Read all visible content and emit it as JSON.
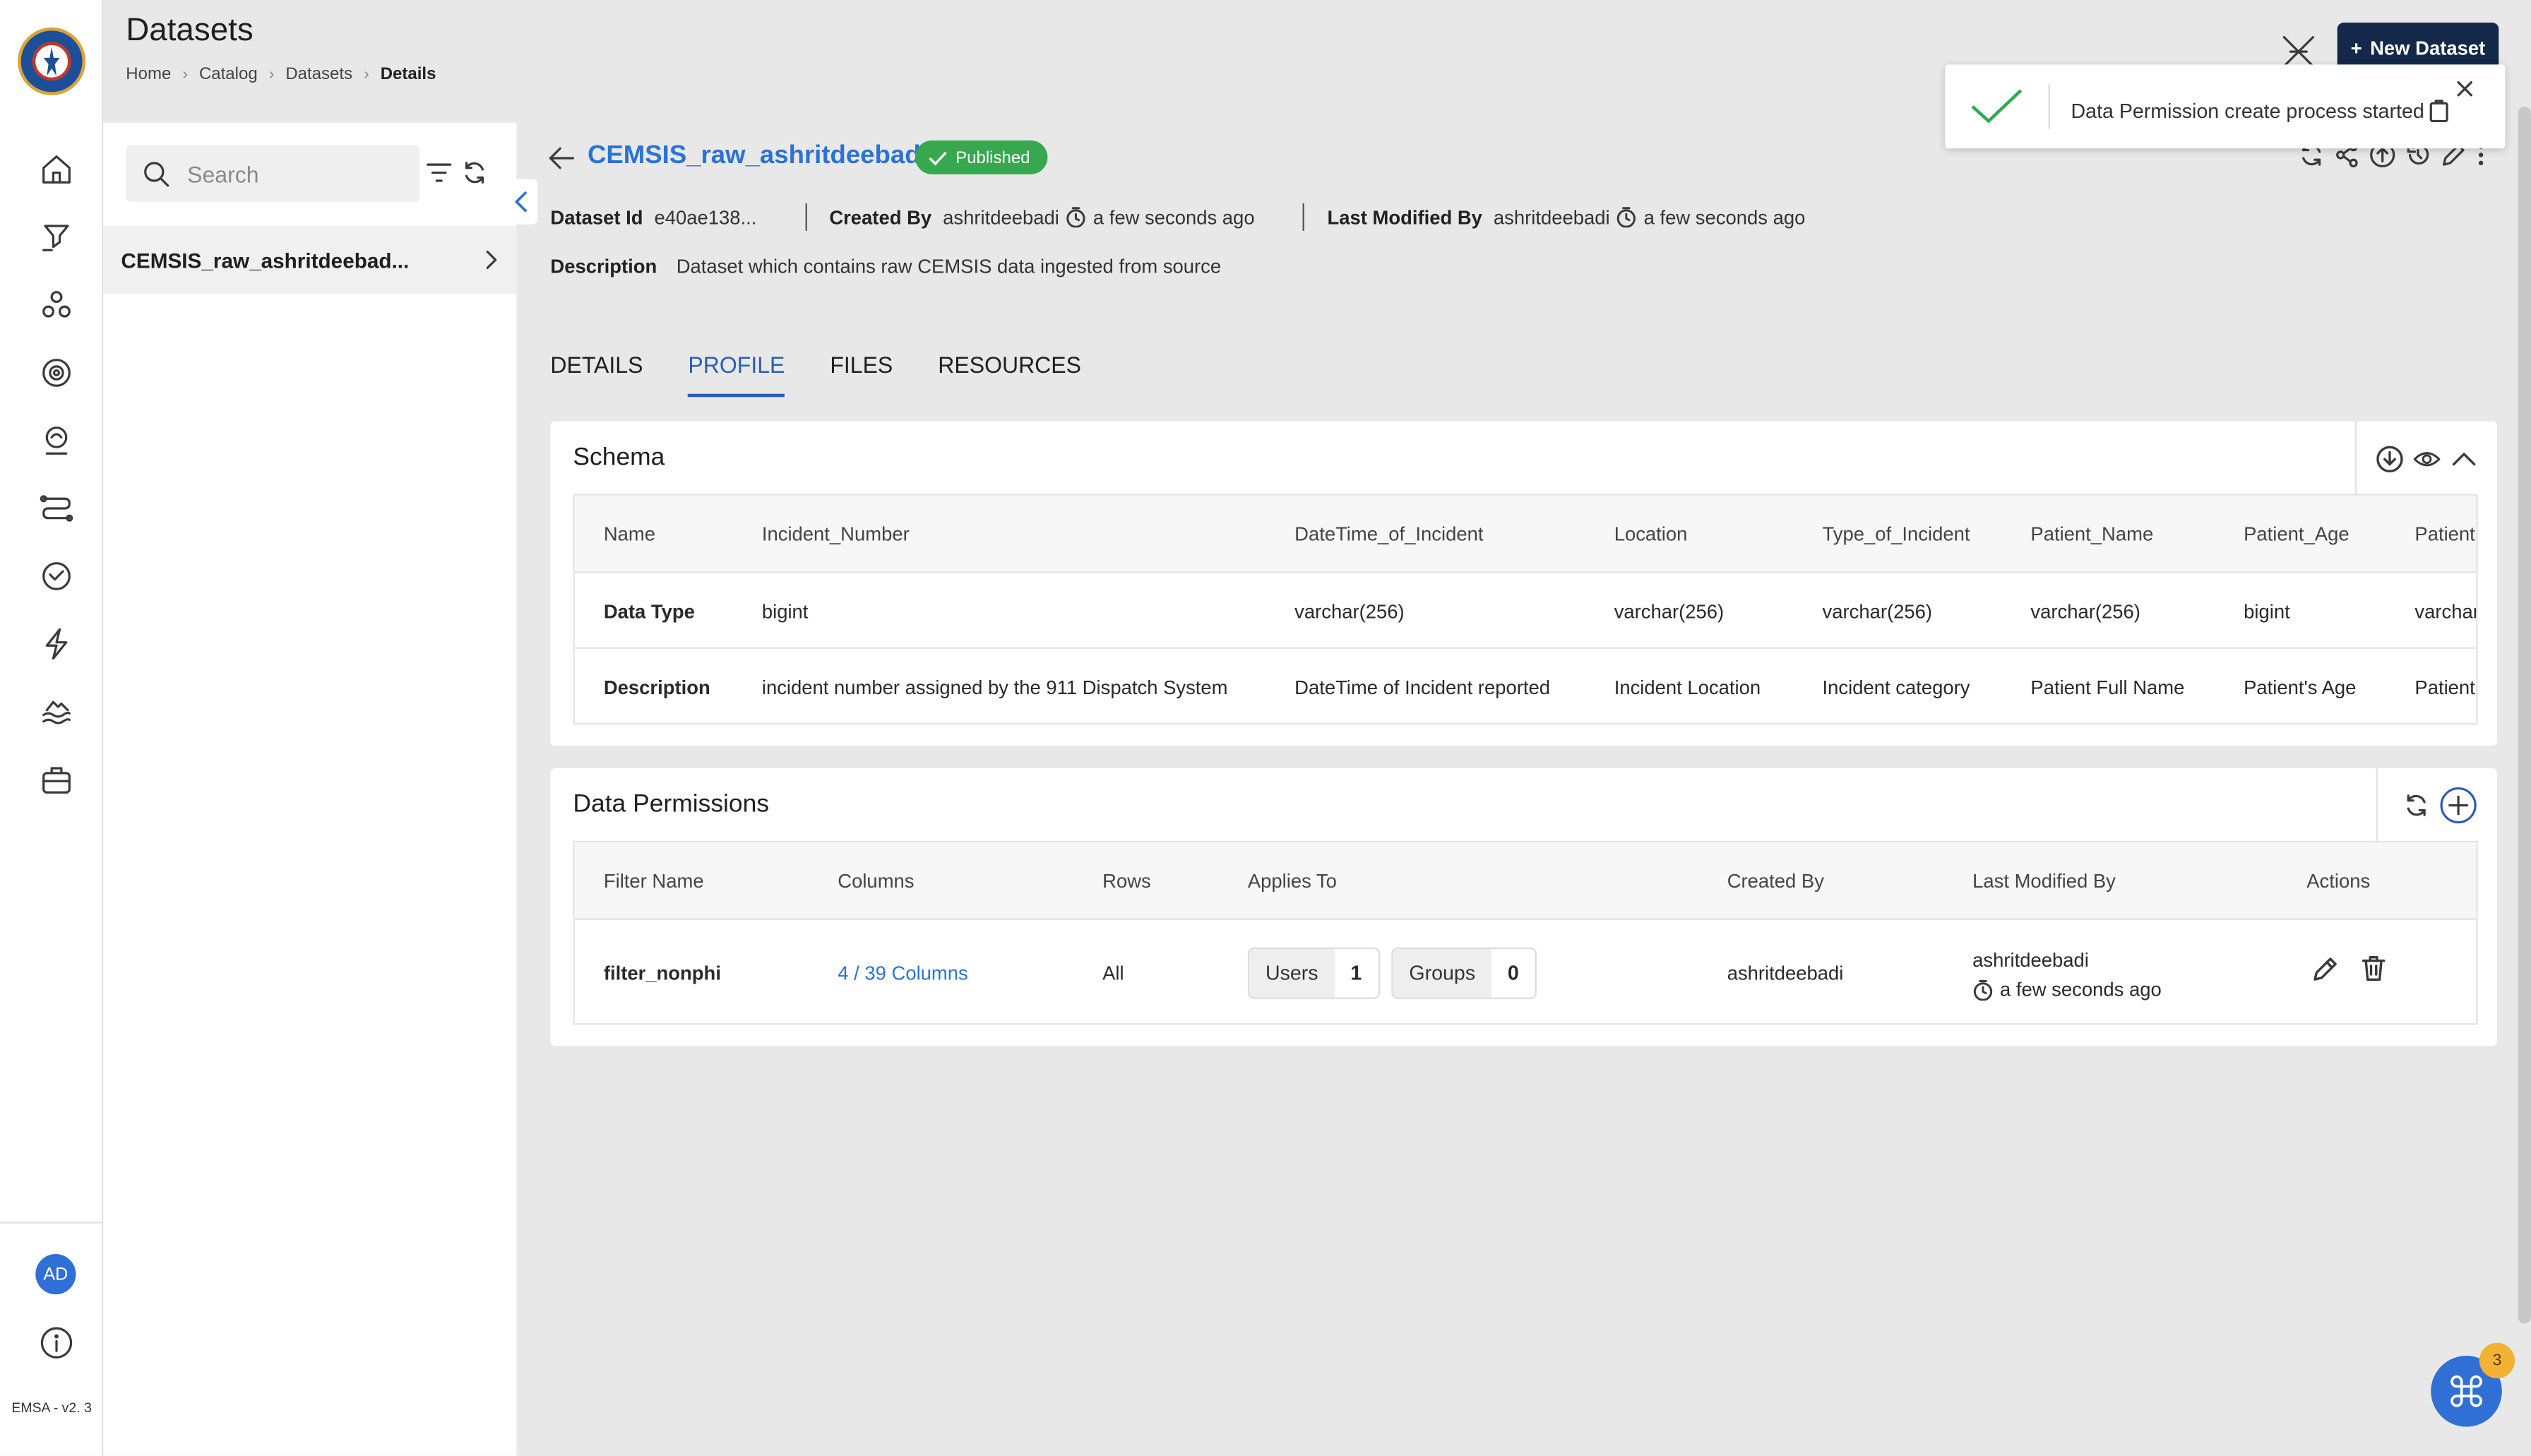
{
  "header": {
    "title": "Datasets",
    "breadcrumb": [
      "Home",
      "Catalog",
      "Datasets",
      "Details"
    ],
    "new_button": "New Dataset"
  },
  "sidebar": {
    "items": [
      "home",
      "pipeline",
      "models",
      "settings",
      "monitor",
      "workflows",
      "history",
      "events",
      "data-lake",
      "toolkit"
    ],
    "avatar": "AD",
    "version": "EMSA - v2. 3"
  },
  "list": {
    "search_placeholder": "Search",
    "item": "CEMSIS_raw_ashritdeebad..."
  },
  "dataset": {
    "name": "CEMSIS_raw_ashritdeebadi",
    "status": "Published",
    "id_label": "Dataset Id",
    "id_value": "e40ae138...",
    "created_by_label": "Created By",
    "created_by": "ashritdeebadi",
    "created_time": "a few seconds ago",
    "modified_by_label": "Last Modified By",
    "modified_by": "ashritdeebadi",
    "modified_time": "a few seconds ago",
    "description_label": "Description",
    "description": "Dataset which contains raw CEMSIS data ingested from source"
  },
  "tabs": [
    "DETAILS",
    "PROFILE",
    "FILES",
    "RESOURCES"
  ],
  "active_tab": "PROFILE",
  "schema": {
    "title": "Schema",
    "row_labels": [
      "Name",
      "Data Type",
      "Description"
    ],
    "columns": [
      {
        "name": "Incident_Number",
        "type": "bigint",
        "description": "incident number assigned by the 911 Dispatch System"
      },
      {
        "name": "DateTime_of_Incident",
        "type": "varchar(256)",
        "description": "DateTime of Incident reported"
      },
      {
        "name": "Location",
        "type": "varchar(256)",
        "description": "Incident Location"
      },
      {
        "name": "Type_of_Incident",
        "type": "varchar(256)",
        "description": "Incident category"
      },
      {
        "name": "Patient_Name",
        "type": "varchar(256)",
        "description": "Patient Full Name"
      },
      {
        "name": "Patient_Age",
        "type": "bigint",
        "description": "Patient's Age"
      },
      {
        "name": "Patient",
        "type": "varchar",
        "description": "Patient"
      }
    ]
  },
  "permissions": {
    "title": "Data Permissions",
    "headers": [
      "Filter Name",
      "Columns",
      "Rows",
      "Applies To",
      "Created By",
      "Last Modified By",
      "Actions"
    ],
    "rows": [
      {
        "filter_name": "filter_nonphi",
        "columns": "4 / 39 Columns",
        "rows": "All",
        "users_label": "Users",
        "users_count": "1",
        "groups_label": "Groups",
        "groups_count": "0",
        "created_by": "ashritdeebadi",
        "modified_by": "ashritdeebadi",
        "modified_time": "a few seconds ago"
      }
    ]
  },
  "toast": {
    "message": "Data Permission create process started"
  },
  "fab": {
    "badge": "3"
  },
  "colors": {
    "accent": "#2a73d3",
    "published": "#37a84f",
    "primary_button": "#14294a",
    "toast_check": "#2eab4f"
  }
}
